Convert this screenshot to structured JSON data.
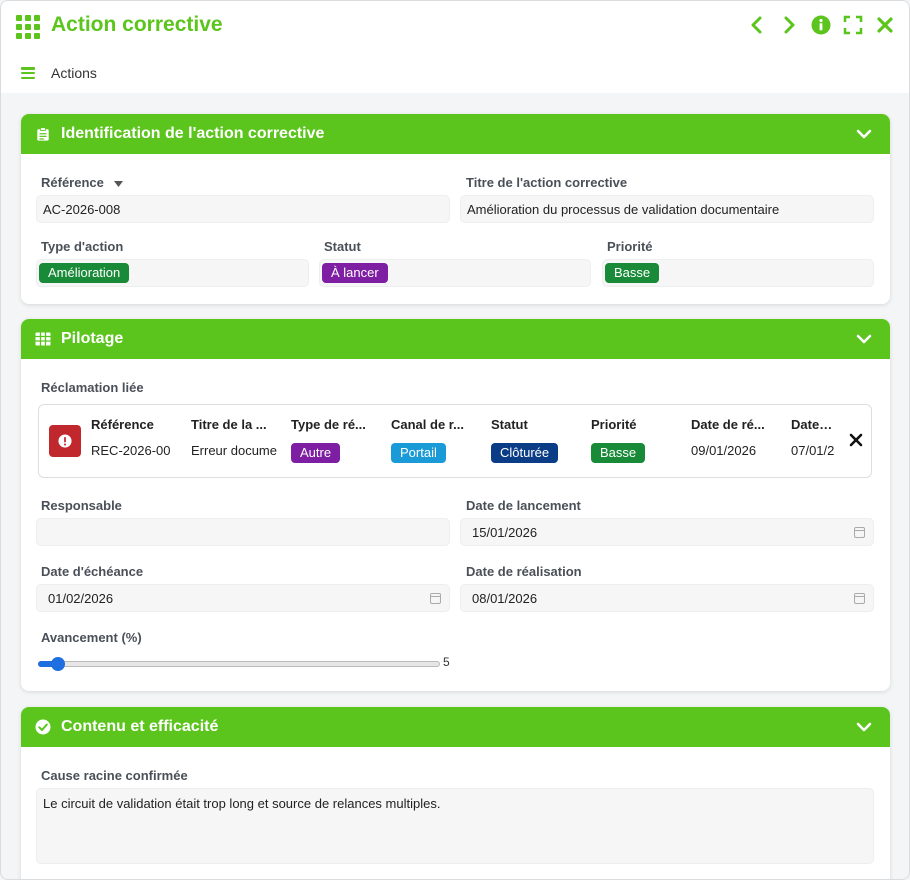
{
  "header": {
    "title": "Action corrective",
    "menu_label": "Actions"
  },
  "colors": {
    "accent": "#5cc51d",
    "danger": "#c0282d",
    "slider": "#1f6fe0"
  },
  "identification": {
    "title": "Identification de l'action corrective",
    "reference_label": "Référence",
    "reference_value": "AC-2026-008",
    "titre_label": "Titre de l'action corrective",
    "titre_value": "Amélioration du processus de validation documentaire",
    "type_label": "Type d'action",
    "type_value": "Amélioration",
    "type_color": "#198a38",
    "statut_label": "Statut",
    "statut_value": "À lancer",
    "statut_color": "#7d1ea3",
    "priorite_label": "Priorité",
    "priorite_value": "Basse",
    "priorite_color": "#198a38"
  },
  "pilotage": {
    "title": "Pilotage",
    "reclamation_label": "Réclamation liée",
    "table": {
      "columns": [
        "Référence",
        "Titre de la ...",
        "Type de ré...",
        "Canal de r...",
        "Statut",
        "Priorité",
        "Date de ré...",
        "Date de"
      ],
      "row": {
        "reference": "REC-2026-00",
        "titre": "Erreur docume",
        "type": "Autre",
        "type_color": "#7d1ea3",
        "canal": "Portail",
        "canal_color": "#1a9bd8",
        "statut": "Clôturée",
        "statut_color": "#0a3d86",
        "priorite": "Basse",
        "priorite_color": "#198a38",
        "date1": "09/01/2026",
        "date2": "07/01/2"
      }
    },
    "responsable_label": "Responsable",
    "responsable_value": "",
    "date_lancement_label": "Date de lancement",
    "date_lancement_value": "15/01/2026",
    "date_echeance_label": "Date d'échéance",
    "date_echeance_value": "01/02/2026",
    "date_realisation_label": "Date de réalisation",
    "date_realisation_value": "08/01/2026",
    "avancement_label": "Avancement (%)",
    "avancement_value": "5"
  },
  "contenu": {
    "title": "Contenu et efficacité",
    "cause_label": "Cause racine confirmée",
    "cause_value": "Le circuit de validation était trop long et source de relances multiples."
  }
}
